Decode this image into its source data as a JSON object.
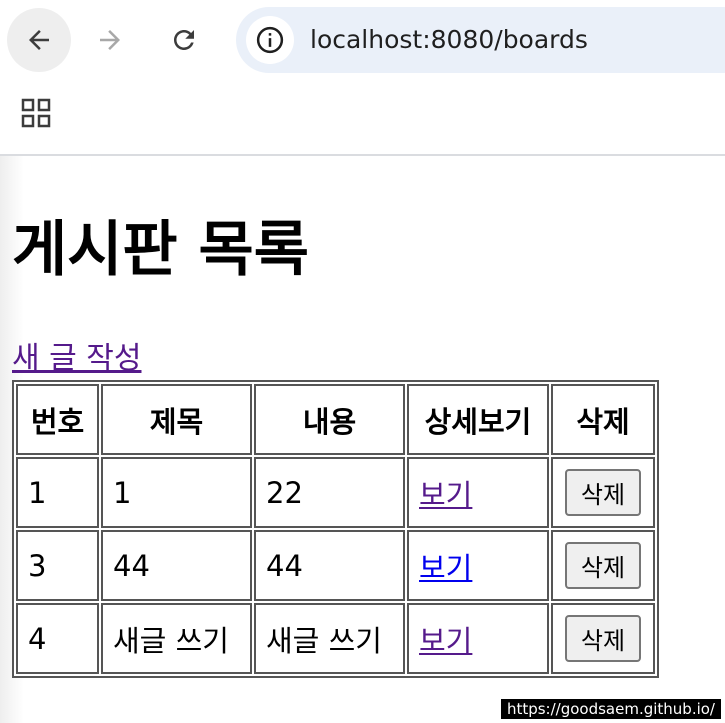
{
  "browser": {
    "url": "localhost:8080/boards",
    "icons": {
      "back": "arrow-left-icon",
      "forward": "arrow-right-icon",
      "reload": "reload-icon",
      "info": "info-icon",
      "apps": "apps-grid-icon"
    }
  },
  "page": {
    "title": "게시판 목록",
    "new_post_link": "새 글 작성"
  },
  "table": {
    "headers": {
      "num": "번호",
      "title": "제목",
      "content": "내용",
      "detail": "상세보기",
      "delete": "삭제"
    },
    "rows": [
      {
        "num": "1",
        "title": "1",
        "content": "22",
        "view_label": "보기",
        "delete_label": "삭제"
      },
      {
        "num": "3",
        "title": "44",
        "content": "44",
        "view_label": "보기",
        "delete_label": "삭제"
      },
      {
        "num": "4",
        "title": "새글 쓰기",
        "content": "새글 쓰기",
        "view_label": "보기",
        "delete_label": "삭제"
      }
    ]
  },
  "watermark": "https://goodsaem.github.io/"
}
